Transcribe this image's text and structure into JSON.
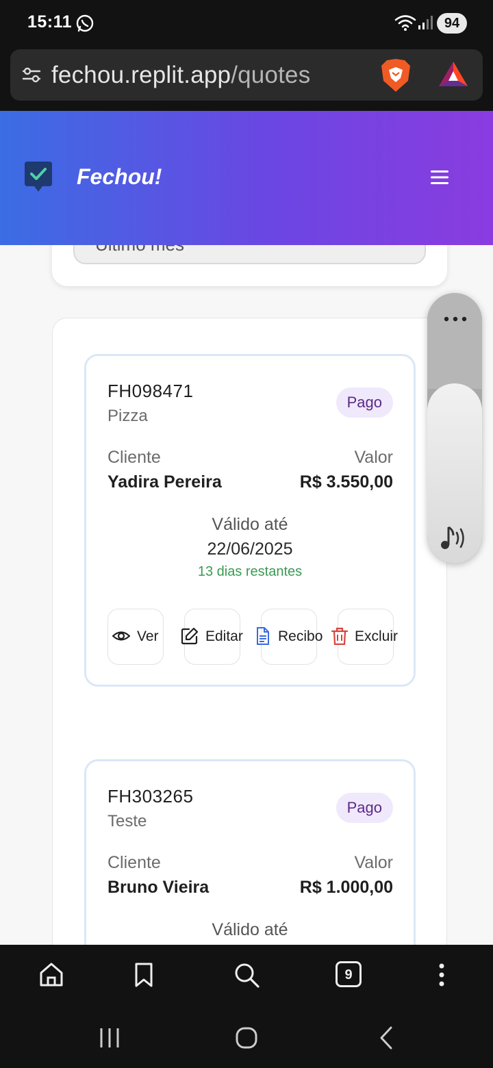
{
  "status_bar": {
    "time": "15:11",
    "battery": "94",
    "icons": [
      "whatsapp-icon",
      "wifi-icon",
      "signal-icon"
    ]
  },
  "browser": {
    "url_domain": "fechou.replit.app",
    "url_path": "/quotes",
    "icons": [
      "site-settings-icon",
      "brave-shields-icon",
      "brave-rewards-icon"
    ]
  },
  "app": {
    "brand": "Fechou!",
    "filter_partial_text": "Último mês",
    "colors": {
      "header_start": "#3b6de4",
      "header_end": "#8a3ce0",
      "badge_bg": "#f0e8fb",
      "remaining": "#3a9a52"
    }
  },
  "quotes": [
    {
      "id": "FH098471",
      "title": "Pizza",
      "status": "Pago",
      "client_label": "Cliente",
      "client": "Yadira Pereira",
      "value_label": "Valor",
      "value": "R$ 3.550,00",
      "valid_label": "Válido até",
      "valid_date": "22/06/2025",
      "remaining": "13 dias restantes",
      "actions": {
        "view": "Ver",
        "edit": "Editar",
        "receipt": "Recibo",
        "delete": "Excluir"
      }
    },
    {
      "id": "FH303265",
      "title": "Teste",
      "status": "Pago",
      "client_label": "Cliente",
      "client": "Bruno Vieira",
      "value_label": "Valor",
      "value": "R$ 1.000,00",
      "valid_label": "Válido até"
    }
  ],
  "bottom_bar": {
    "tab_count": "9",
    "icons": [
      "home-icon",
      "bookmark-icon",
      "search-icon",
      "tabs-icon",
      "more-icon"
    ]
  },
  "nav_bar": {
    "icons": [
      "recents-icon",
      "home-circle-icon",
      "back-icon"
    ]
  }
}
